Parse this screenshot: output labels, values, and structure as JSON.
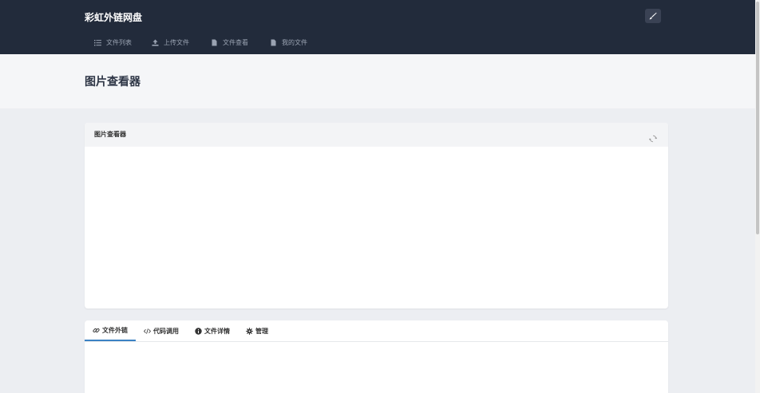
{
  "app": {
    "brand": "彩虹外链网盘"
  },
  "nav": [
    {
      "label": "文件列表",
      "icon": "list-icon"
    },
    {
      "label": "上传文件",
      "icon": "upload-icon"
    },
    {
      "label": "文件查看",
      "icon": "file-icon"
    },
    {
      "label": "我的文件",
      "icon": "file-icon"
    }
  ],
  "page": {
    "title": "图片查看器"
  },
  "viewer": {
    "title": "图片查看器",
    "refresh_icon": "refresh-icon"
  },
  "tabs": [
    {
      "label": "文件外链",
      "icon": "link-icon",
      "active": true
    },
    {
      "label": "代码调用",
      "icon": "code-icon",
      "active": false
    },
    {
      "label": "文件详情",
      "icon": "info-icon",
      "active": false
    },
    {
      "label": "管理",
      "icon": "gear-icon",
      "active": false
    }
  ],
  "colors": {
    "header_bg": "#222b3b",
    "accent": "#3b82c4",
    "page_bg": "#eceef2"
  }
}
